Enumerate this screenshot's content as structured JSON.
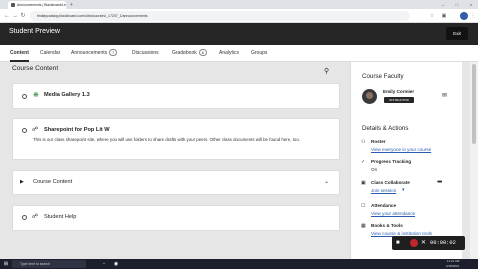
{
  "browser": {
    "tab_title": "Announcements | Blackboard Learn",
    "url": "findlaycatalog.blackboard.com/ultra/courses/_17207_1/announcements",
    "close_tab_glyph": "×",
    "new_tab_glyph": "+"
  },
  "header": {
    "title": "Student Preview",
    "exit_label": "Exit"
  },
  "nav": {
    "content": "Content",
    "calendar": "Calendar",
    "announcements": "Announcements",
    "announcements_count": "7",
    "discussions": "Discussions",
    "gradebook": "Gradebook",
    "gradebook_count": "6",
    "analytics": "Analytics",
    "groups": "Groups"
  },
  "content": {
    "heading": "Course Content",
    "items": [
      {
        "title": "Media Gallery 1.3",
        "icon": "media-gallery-icon"
      },
      {
        "title": "Sharepoint for Pop Lit W",
        "icon": "link-icon",
        "description": "This is our class sharepoint site, where you will use folders to share drafts with your peers. Other class documents will be found here, too."
      },
      {
        "title": "Course Content",
        "icon": "folder-icon"
      },
      {
        "title": "Student Help",
        "icon": "link-icon"
      }
    ]
  },
  "sidebar": {
    "faculty_title": "Course Faculty",
    "faculty_name": "Emily Cormier",
    "faculty_role": "INSTRUCTOR",
    "details_title": "Details & Actions",
    "roster_label": "Roster",
    "roster_link": "View everyone in your course",
    "progress_label": "Progress Tracking",
    "progress_value": "On",
    "collab_label": "Class Collaborate",
    "collab_link": "Join session",
    "attendance_label": "Attendance",
    "attendance_link": "View your attendance",
    "books_label": "Books & Tools",
    "books_link": "View course & institution tools"
  },
  "recorder": {
    "time": "00:00:02"
  },
  "taskbar": {
    "search_placeholder": "Type here to search",
    "time": "11:21 AM",
    "date": "2/18/2021"
  },
  "colors": {
    "header_bg": "#262626",
    "link": "#2a5db0",
    "record": "#c0262d"
  }
}
